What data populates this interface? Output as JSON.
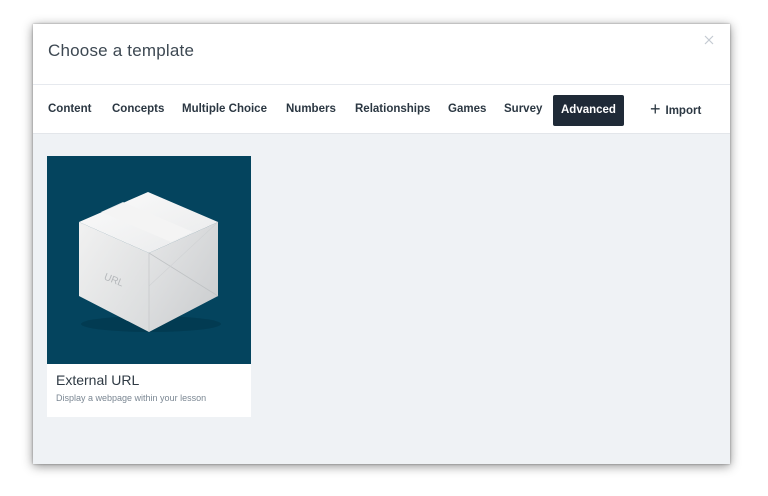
{
  "modal": {
    "title": "Choose a template",
    "close_icon": "close-icon"
  },
  "tabs": [
    {
      "label": "Content",
      "active": false
    },
    {
      "label": "Concepts",
      "active": false
    },
    {
      "label": "Multiple Choice",
      "active": false
    },
    {
      "label": "Numbers",
      "active": false
    },
    {
      "label": "Relationships",
      "active": false
    },
    {
      "label": "Games",
      "active": false
    },
    {
      "label": "Survey",
      "active": false
    },
    {
      "label": "Advanced",
      "active": true
    }
  ],
  "import": {
    "icon": "plus-icon",
    "label": "Import"
  },
  "templates": [
    {
      "title": "External URL",
      "description": "Display a webpage within your lesson",
      "thumbnail_label": "URL",
      "thumbnail_icon": "box-icon",
      "thumbnail_bg": "#04445e"
    }
  ],
  "colors": {
    "active_tab_bg": "#1f2a37",
    "content_bg": "#eff2f5"
  }
}
